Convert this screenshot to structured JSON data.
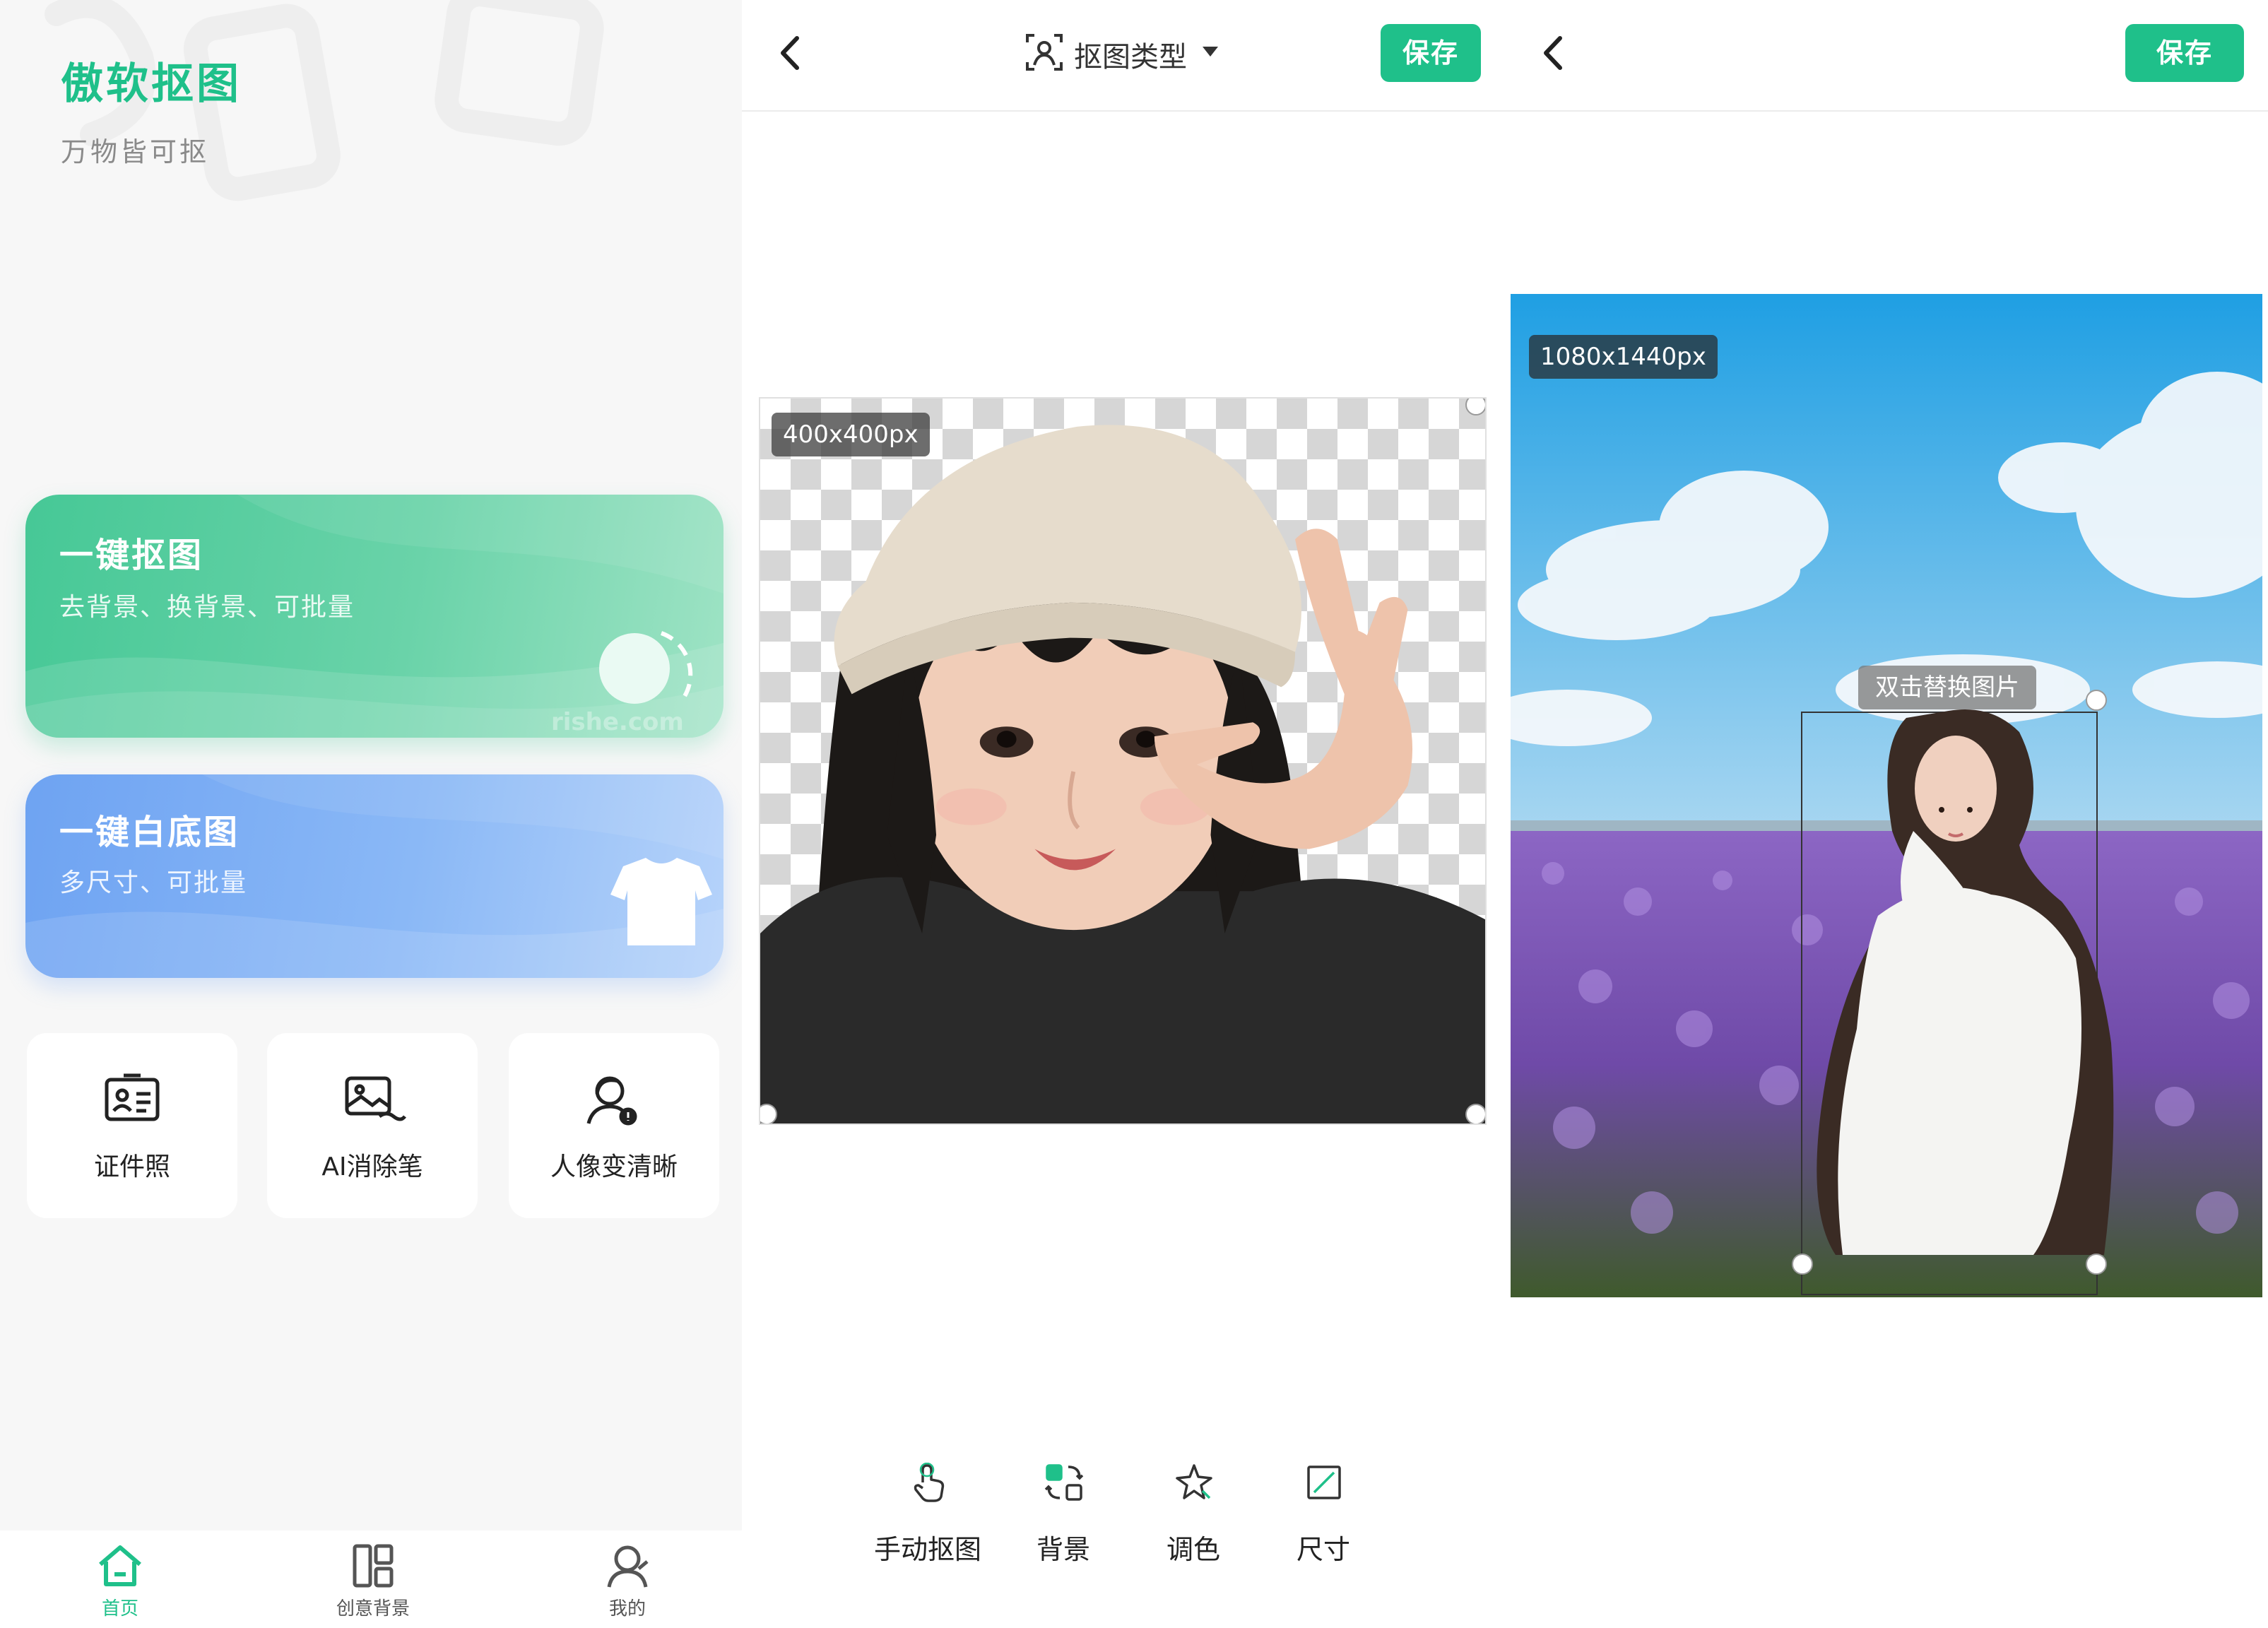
{
  "home": {
    "app_title": "傲软抠图",
    "app_subtitle": "万物皆可抠",
    "card_primary": {
      "title": "一键抠图",
      "desc": "去背景、换背景、可批量",
      "watermark": "rishe.com"
    },
    "card_secondary": {
      "title": "一键白底图",
      "desc": "多尺寸、可批量"
    },
    "tools": [
      {
        "label": "证件照",
        "icon": "id-card-icon"
      },
      {
        "label": "AI消除笔",
        "icon": "image-eraser-icon"
      },
      {
        "label": "人像变清晰",
        "icon": "portrait-enhance-icon"
      }
    ],
    "bottom_nav": [
      {
        "label": "首页",
        "icon": "home-icon",
        "active": true
      },
      {
        "label": "创意背景",
        "icon": "layout-icon",
        "active": false
      },
      {
        "label": "我的",
        "icon": "user-icon",
        "active": false
      }
    ]
  },
  "editor": {
    "type_selector": "抠图类型",
    "save_label": "保存",
    "size_badge": "400x400px",
    "tools": [
      {
        "label": "手动抠图",
        "icon": "hand-pointer-icon"
      },
      {
        "label": "背景",
        "icon": "background-swap-icon"
      },
      {
        "label": "调色",
        "icon": "color-adjust-icon"
      },
      {
        "label": "尺寸",
        "icon": "crop-size-icon"
      }
    ]
  },
  "composite": {
    "save_label": "保存",
    "size_badge": "1080x1440px",
    "replace_tip": "双击替换图片"
  },
  "colors": {
    "brand": "#1fc08a",
    "card_green": "#46c896",
    "card_blue": "#6ea3f2"
  }
}
